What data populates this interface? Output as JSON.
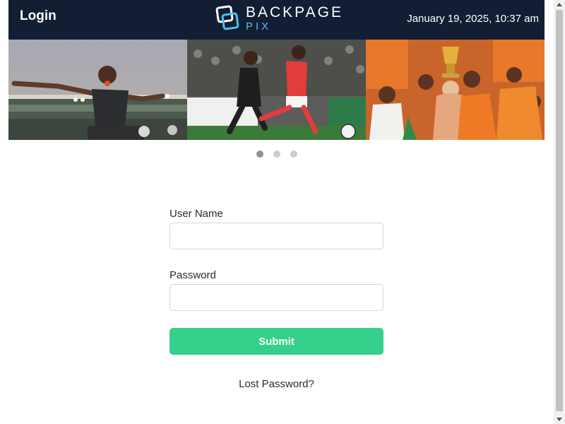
{
  "header": {
    "title": "Login",
    "logo_brand": "BACKPAGE",
    "logo_sub": "PIX",
    "datetime": "January 19, 2025, 10:37 am",
    "background_color": "#131e35",
    "accent_color": "#4ec3e8"
  },
  "carousel": {
    "slides": [
      "soccer-celebration-photo",
      "soccer-match-photo",
      "trophy-celebration-photo"
    ],
    "dot_count": 3,
    "active_index": 0
  },
  "form": {
    "username_label": "User Name",
    "username_value": "",
    "username_placeholder": "",
    "password_label": "Password",
    "password_value": "",
    "password_placeholder": "",
    "submit_label": "Submit",
    "submit_color": "#34d08b"
  },
  "lost_password": "Lost Password?"
}
